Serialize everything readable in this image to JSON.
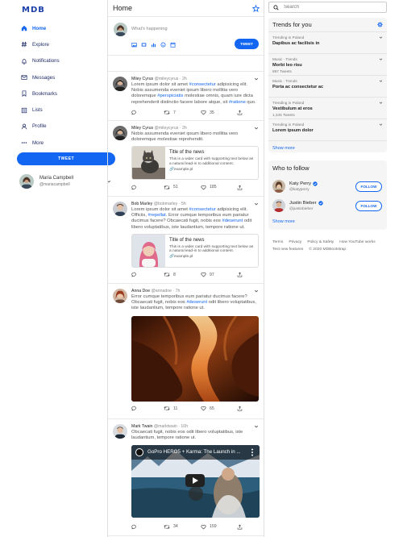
{
  "brand": "MDB",
  "nav": [
    {
      "label": "Home",
      "icon": "home-icon",
      "active": true
    },
    {
      "label": "Explore",
      "icon": "hashtag-icon"
    },
    {
      "label": "Notifications",
      "icon": "bell-icon"
    },
    {
      "label": "Messages",
      "icon": "envelope-icon"
    },
    {
      "label": "Bookmarks",
      "icon": "bookmark-icon"
    },
    {
      "label": "Lists",
      "icon": "list-icon"
    },
    {
      "label": "Profile",
      "icon": "user-icon"
    },
    {
      "label": "More",
      "icon": "more-icon"
    }
  ],
  "sidebar": {
    "tweet_label": "TWEET",
    "user": {
      "name": "Maria Campbell",
      "handle": "@mariacampbell"
    }
  },
  "feed": {
    "title": "Home",
    "composer": {
      "placeholder": "What's happening",
      "tweet_label": "TWEET"
    },
    "posts": [
      {
        "name": "Miley Cyrus",
        "handle": "@mileycyrus",
        "time": "2h",
        "text_parts": [
          "Lorem ipsum dolor sit amet ",
          "#consectetur",
          " adipisicing elit. Nobis assumenda eveniet ipsum libero mollitia vero doloremque ",
          "#perspiciatis",
          " molestiae omnis, quam iure dicta reprehenderit distinctio facere labore atque, sit ",
          "#ratione",
          " quo."
        ],
        "comments": "",
        "retweets": "7",
        "likes": "35"
      },
      {
        "name": "Miley Cyrus",
        "handle": "@mileycyrus",
        "time": "2h",
        "text_parts": [
          "Nobis assumenda eveniet ipsum libero mollitia vero doloremque molestiae reprehendit."
        ],
        "card": {
          "title": "Title of the news",
          "desc": "This is a wider card with supporting text below as a natural lead-in to additional content.",
          "link": "example.pl"
        },
        "comments": "",
        "retweets": "51",
        "likes": "185"
      },
      {
        "name": "Bob Marley",
        "handle": "@bobmarley",
        "time": "5h",
        "text_parts": [
          "Lorem ipsum dolor sit amet ",
          "#consectetur",
          " adipisicing elit. Officiis, ",
          "#repellat",
          ". Error cumque temporibus eum pariatur ducimus facere? Obcaecati fugit, nobis eos ",
          "#deserunt",
          " odit libero voluptatibus, iste laudantium, tempore ratione ut."
        ],
        "card": {
          "title": "Title of the news",
          "desc": "This is a wider card with supporting text below as a natural lead-in to additional content.",
          "link": "example.pl"
        },
        "comments": "",
        "retweets": "8",
        "likes": "97"
      },
      {
        "name": "Anna Doe",
        "handle": "@annadoe",
        "time": "7h",
        "text_parts": [
          "Error cumque temporibus eum pariatur ducimus facere? Obcaecati fugit, nobis eos ",
          "#deserunt",
          " odit libero voluptatibus, iste laudantium, tempore ratione ut."
        ],
        "comments": "",
        "retweets": "11",
        "likes": "65"
      },
      {
        "name": "Mark Twain",
        "handle": "@marktwain",
        "time": "10h",
        "text_parts": [
          "Obcaecati fugit, nobis eos odit libero voluptatibus, iste laudantium, tempore ratione ut."
        ],
        "video_title": "GoPro HERO5 + Karma: The Launch in ...",
        "comments": "",
        "retweets": "34",
        "likes": "159"
      }
    ]
  },
  "search": {
    "placeholder": "Search"
  },
  "trends": {
    "title": "Trends for you",
    "items": [
      {
        "category": "Trending in Poland",
        "title": "Dapibus ac facilisis in",
        "count": ""
      },
      {
        "category": "Music · Trends",
        "title": "Morbi leo risu",
        "count": "897 Tweets"
      },
      {
        "category": "Music · Trends",
        "title": "Porta ac consectetur ac",
        "count": ""
      },
      {
        "category": "Trending in Poland",
        "title": "Vestibulum at eros",
        "count": "1,345 Tweets"
      },
      {
        "category": "Trending in Poland",
        "title": "Lorem ipsum dolor",
        "count": ""
      }
    ],
    "show_more": "Show more"
  },
  "who_to_follow": {
    "title": "Who to follow",
    "items": [
      {
        "name": "Katy Perry",
        "handle": "@katyperry",
        "button": "FOLLOW"
      },
      {
        "name": "Justin Bieber",
        "handle": "@justinbieber",
        "button": "FOLLOW"
      }
    ],
    "show_more": "Show more"
  },
  "footer": {
    "links": [
      "Terms",
      "Privacy",
      "Policy & Safety",
      "How YouTube works",
      "Test new features"
    ],
    "copyright": "© 2020 MDBootstrap"
  },
  "colors": {
    "accent": "#1266f1",
    "brand": "#1c3faa",
    "panel": "#f5f5f5"
  }
}
